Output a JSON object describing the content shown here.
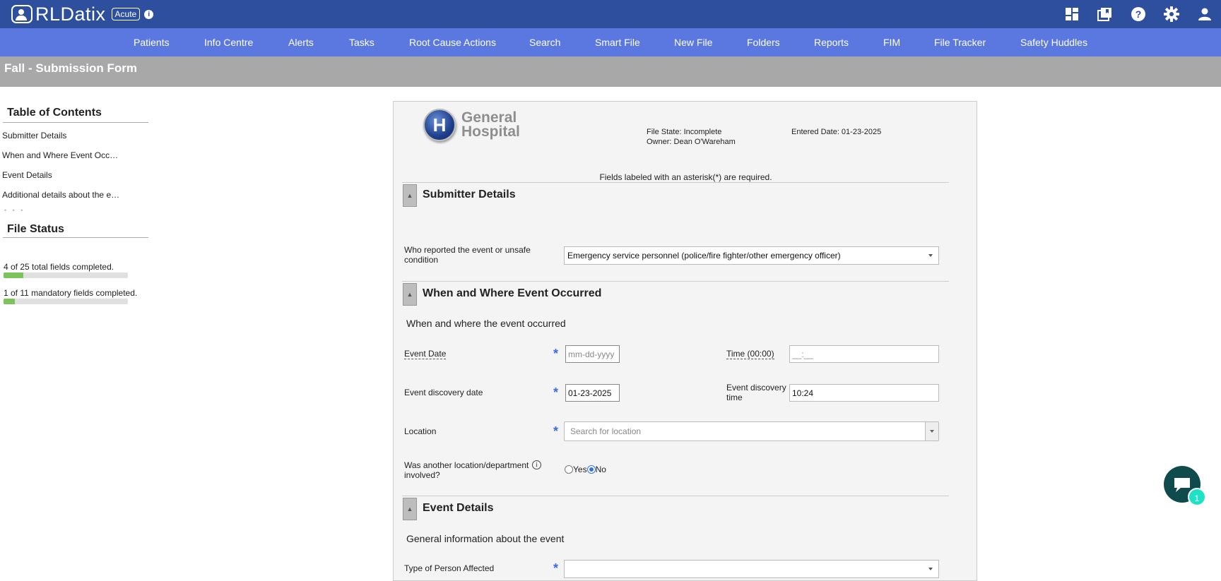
{
  "app": {
    "logo_text": "RLDatix",
    "badge": "Acute",
    "icons": [
      "dashboard-icon",
      "library-icon",
      "help-icon",
      "gear-icon",
      "user-icon"
    ]
  },
  "nav": {
    "items": [
      "Patients",
      "Info Centre",
      "Alerts",
      "Tasks",
      "Root Cause Actions",
      "Search",
      "Smart File",
      "New File",
      "Folders",
      "Reports",
      "FIM",
      "File Tracker",
      "Safety Huddles"
    ]
  },
  "page": {
    "title": "Fall - Submission Form"
  },
  "sidebar": {
    "toc_title": "Table of Contents",
    "toc_items": [
      "Submitter Details",
      "When and Where Event Occ…",
      "Event Details",
      "Additional details about the e…"
    ],
    "more": "• • •",
    "status_title": "File Status",
    "total_fields": {
      "text": "4 of 25 total fields completed.",
      "progress": 0.16
    },
    "mandatory_fields": {
      "text": "1 of 11 mandatory fields completed.",
      "progress": 0.09
    }
  },
  "form": {
    "hospital_line1": "General",
    "hospital_line2": "Hospital",
    "hospital_mark": "H",
    "file_state": "File State: Incomplete",
    "owner": "Owner: Dean O'Wareham",
    "entered_date": "Entered Date: 01-23-2025",
    "required_note": "Fields labeled with an asterisk(*) are required.",
    "sections": {
      "submitter": {
        "title": "Submitter Details",
        "who_reported_label": "Who reported the event or unsafe condition",
        "who_reported_value": "Emergency service personnel (police/fire fighter/other emergency officer)"
      },
      "when_where": {
        "title": "When and Where Event Occurred",
        "subtitle": "When and where the event occurred",
        "event_date_label": "Event Date",
        "event_date_placeholder": "mm-dd-yyyy",
        "time_label": "Time (00:00)",
        "time_placeholder": "__:__",
        "discovery_date_label": "Event discovery date",
        "discovery_date_value": "01-23-2025",
        "discovery_time_label": "Event discovery time",
        "discovery_time_value": "10:24",
        "location_label": "Location",
        "location_placeholder": "Search for location",
        "another_location_label": "Was another location/department involved?",
        "yes_label": "Yes",
        "no_label": "No"
      },
      "event_details": {
        "title": "Event Details",
        "subtitle": "General information about the event",
        "person_type_label": "Type of Person Affected"
      }
    },
    "required_mark": "*"
  },
  "chat": {
    "badge_count": "1"
  }
}
